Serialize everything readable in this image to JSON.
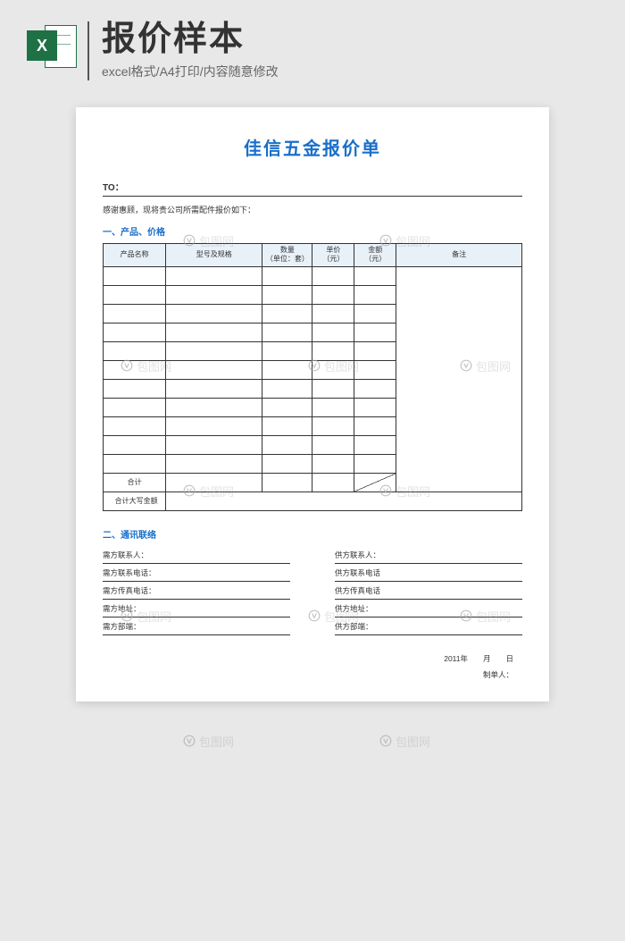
{
  "header": {
    "icon_letter": "X",
    "title": "报价样本",
    "subtitle": "excel格式/A4打印/内容随意修改"
  },
  "document": {
    "title": "佳信五金报价单",
    "to_label": "TO：",
    "intro": "感谢惠顾，现将贵公司所需配件报价如下：",
    "section1_title": "一、产品、价格",
    "columns": {
      "name": "产品名称",
      "model": "型号及规格",
      "qty": "数量\n（单位：套）",
      "price": "单价\n（元）",
      "amount": "金额\n（元）",
      "remark": "备注"
    },
    "total_label": "合计",
    "total_text_label": "合计大写金额",
    "section2_title": "二、通讯联络",
    "contact": {
      "buyer_contact": "需方联系人：",
      "buyer_phone": "需方联系电话：",
      "buyer_fax": "需方传真电话：",
      "buyer_addr": "需方地址：",
      "buyer_dept": "需方部端：",
      "supplier_contact": "供方联系人：",
      "supplier_phone": "供方联系电话",
      "supplier_fax": "供方传真电话",
      "supplier_addr": "供方地址：",
      "supplier_dept": "供方部端："
    },
    "date_line": "2011年　　月　　日",
    "maker": "制单人："
  },
  "watermark_text": "包图网"
}
